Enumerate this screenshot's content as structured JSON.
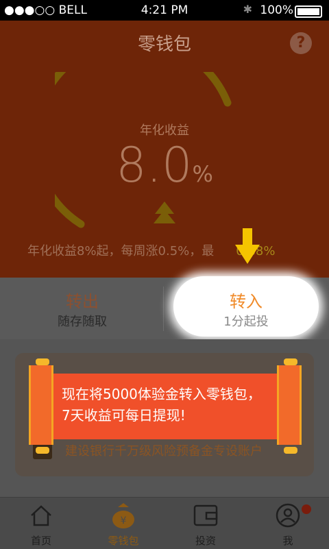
{
  "status_bar": {
    "carrier": "●●●○○ BELL",
    "time": "4:21 PM",
    "battery": "100%"
  },
  "header": {
    "title": "零钱包",
    "help": "?"
  },
  "gauge": {
    "label": "年化收益",
    "value": "8.0",
    "unit": "%"
  },
  "promo": {
    "prefix": "年化收益8%起，每周涨0.5%，最",
    "suffix": "0.88%"
  },
  "actions": {
    "transfer_out": {
      "title": "转出",
      "subtitle": "随存随取"
    },
    "transfer_in": {
      "title": "转入",
      "subtitle": "1分起投"
    }
  },
  "banner": {
    "text": "现在将5000体验金转入零钱包，7天收益可每日提现!"
  },
  "card": {
    "bank_text": "建设银行千万级风险预备金专设账户"
  },
  "tabbar": {
    "items": [
      {
        "label": "首页",
        "icon": "home-icon"
      },
      {
        "label": "零钱包",
        "icon": "wallet-icon"
      },
      {
        "label": "投资",
        "icon": "invest-icon"
      },
      {
        "label": "我",
        "icon": "profile-icon"
      }
    ]
  },
  "colors": {
    "header_bg": "#6e2508",
    "accent": "#f08a28",
    "banner": "#f0502a",
    "arrow": "#f5c400"
  }
}
